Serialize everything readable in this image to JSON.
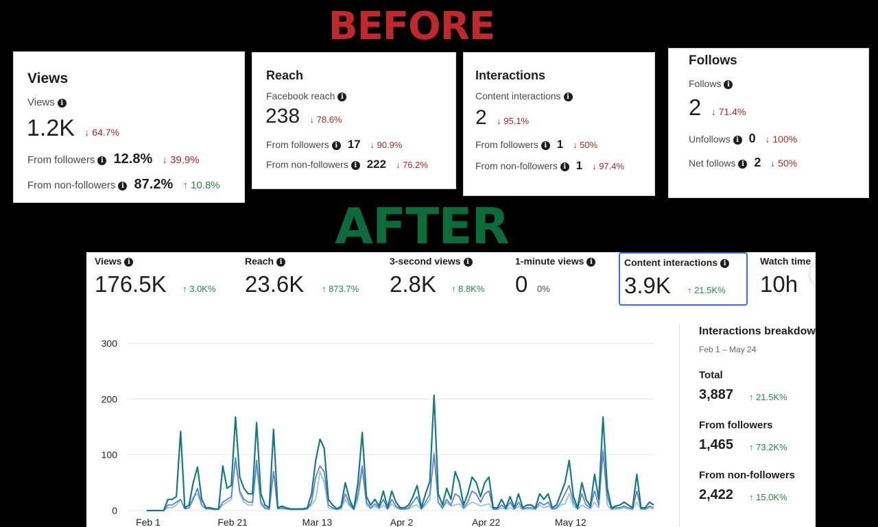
{
  "headings": {
    "before": "BEFORE",
    "after": "AFTER"
  },
  "before_cards": {
    "views": {
      "title": "Views",
      "metric_label": "Views",
      "value": "1.2K",
      "change": "↓ 64.7%",
      "rows": [
        {
          "label": "From followers",
          "value": "12.8%",
          "change": "↓ 39.9%",
          "direction": "down"
        },
        {
          "label": "From non-followers",
          "value": "87.2%",
          "change": "↑ 10.8%",
          "direction": "up"
        }
      ]
    },
    "reach": {
      "title": "Reach",
      "metric_label": "Facebook reach",
      "value": "238",
      "change": "↓ 78.6%",
      "rows": [
        {
          "label": "From followers",
          "value": "17",
          "change": "↓ 90.9%",
          "direction": "down"
        },
        {
          "label": "From non-followers",
          "value": "222",
          "change": "↓ 76.2%",
          "direction": "down"
        }
      ]
    },
    "interactions": {
      "title": "Interactions",
      "metric_label": "Content interactions",
      "value": "2",
      "change": "↓ 95.1%",
      "rows": [
        {
          "label": "From followers",
          "value": "1",
          "change": "↓ 50%",
          "direction": "down"
        },
        {
          "label": "From non-followers",
          "value": "1",
          "change": "↓ 97.4%",
          "direction": "down"
        }
      ]
    },
    "follows": {
      "title": "Follows",
      "metric_label": "Follows",
      "value": "2",
      "change": "↓ 71.4%",
      "rows": [
        {
          "label": "Unfollows",
          "value": "0",
          "change": "↓ 100%",
          "direction": "down"
        },
        {
          "label": "Net follows",
          "value": "2",
          "change": "↓ 50%",
          "direction": "down"
        }
      ]
    }
  },
  "after_tabs": [
    {
      "label": "Views",
      "value": "176.5K",
      "change": "↑ 3.0K%",
      "direction": "up",
      "info": true
    },
    {
      "label": "Reach",
      "value": "23.6K",
      "change": "↑ 873.7%",
      "direction": "up",
      "info": true
    },
    {
      "label": "3-second views",
      "value": "2.8K",
      "change": "↑ 8.8K%",
      "direction": "up",
      "info": true
    },
    {
      "label": "1-minute views",
      "value": "0",
      "change": "0%",
      "direction": "neutral",
      "info": true
    },
    {
      "label": "Content interactions",
      "value": "3.9K",
      "change": "↑ 21.5K%",
      "direction": "up",
      "info": true,
      "selected": true
    },
    {
      "label": "Watch time",
      "value": "10h",
      "change": "",
      "direction": "neutral",
      "info": false
    }
  ],
  "breakdown": {
    "title": "Interactions breakdown",
    "date_range": "Feb 1 – May 24",
    "items": [
      {
        "label": "Total",
        "value": "3,887",
        "change": "↑ 21.5K%"
      },
      {
        "label": "From followers",
        "value": "1,465",
        "change": "↑ 73.2K%"
      },
      {
        "label": "From non-followers",
        "value": "2,422",
        "change": "↑ 15.0K%"
      }
    ]
  },
  "colors": {
    "before": "#c0282c",
    "after": "#0b6b3a",
    "down": "#b3261e",
    "up": "#1d8a4a",
    "series_total": "#147a7a",
    "series_followers": "#5d7fd6",
    "series_nonfollowers": "#8fc4e0"
  },
  "chart_data": {
    "type": "line",
    "y_ticks": [
      "0",
      "100",
      "200",
      "300"
    ],
    "ylim": [
      0,
      300
    ],
    "x_tick_labels": [
      "Feb 1",
      "Feb 21",
      "Mar 13",
      "Apr 2",
      "Apr 22",
      "May 12"
    ],
    "grid": true,
    "x_start": "Feb 1",
    "x_end": "May 24",
    "series": [
      {
        "values": [
          0,
          0,
          0,
          0,
          0,
          20,
          20,
          25,
          142,
          5,
          10,
          50,
          78,
          20,
          5,
          5,
          3,
          3,
          80,
          40,
          45,
          168,
          60,
          40,
          30,
          30,
          158,
          30,
          10,
          5,
          146,
          5,
          8,
          5,
          3,
          3,
          3,
          3,
          5,
          30,
          90,
          128,
          112,
          20,
          10,
          3,
          8,
          50,
          20,
          3,
          50,
          140,
          25,
          10,
          20,
          8,
          35,
          5,
          35,
          15,
          5,
          5,
          10,
          25,
          45,
          5,
          30,
          52,
          207,
          30,
          10,
          40,
          20,
          70,
          50,
          10,
          30,
          60,
          50,
          25,
          50,
          60,
          5,
          5,
          20,
          5,
          25,
          5,
          30,
          5,
          10,
          10,
          5,
          30,
          20,
          30,
          5,
          10,
          30,
          50,
          90,
          25,
          5,
          50,
          20,
          8,
          65,
          20,
          168,
          40,
          5,
          8,
          10,
          15,
          10,
          5,
          65,
          5,
          5,
          15,
          10
        ]
      },
      {
        "values": [
          0,
          0,
          0,
          0,
          0,
          5,
          5,
          10,
          20,
          3,
          5,
          25,
          30,
          10,
          3,
          3,
          2,
          2,
          10,
          15,
          20,
          90,
          30,
          15,
          10,
          10,
          80,
          10,
          3,
          2,
          70,
          3,
          3,
          3,
          2,
          2,
          2,
          2,
          3,
          10,
          20,
          70,
          50,
          5,
          3,
          2,
          3,
          20,
          8,
          2,
          20,
          75,
          10,
          3,
          8,
          3,
          10,
          2,
          12,
          5,
          2,
          2,
          3,
          8,
          10,
          2,
          10,
          20,
          105,
          15,
          3,
          15,
          8,
          10,
          12,
          3,
          10,
          15,
          12,
          8,
          10,
          12,
          2,
          2,
          5,
          2,
          5,
          2,
          8,
          2,
          3,
          3,
          2,
          10,
          5,
          8,
          2,
          3,
          10,
          12,
          30,
          8,
          2,
          10,
          5,
          3,
          15,
          5,
          110,
          10,
          2,
          3,
          3,
          5,
          3,
          2,
          15,
          2,
          2,
          5,
          3
        ]
      },
      {
        "values": [
          0,
          0,
          0,
          0,
          0,
          10,
          10,
          15,
          20,
          3,
          5,
          20,
          40,
          10,
          3,
          3,
          2,
          2,
          15,
          20,
          25,
          95,
          35,
          20,
          15,
          15,
          90,
          15,
          5,
          3,
          70,
          3,
          5,
          3,
          2,
          2,
          2,
          2,
          3,
          15,
          60,
          80,
          70,
          10,
          5,
          2,
          5,
          30,
          12,
          2,
          30,
          80,
          15,
          5,
          12,
          5,
          20,
          3,
          20,
          8,
          3,
          3,
          5,
          15,
          25,
          3,
          15,
          30,
          100,
          15,
          5,
          20,
          10,
          30,
          25,
          5,
          15,
          35,
          30,
          15,
          30,
          35,
          3,
          3,
          10,
          3,
          15,
          3,
          15,
          3,
          5,
          5,
          3,
          15,
          10,
          15,
          3,
          5,
          15,
          30,
          45,
          15,
          3,
          30,
          10,
          5,
          35,
          10,
          105,
          25,
          3,
          5,
          5,
          8,
          5,
          3,
          35,
          3,
          3,
          8,
          5
        ]
      }
    ]
  }
}
